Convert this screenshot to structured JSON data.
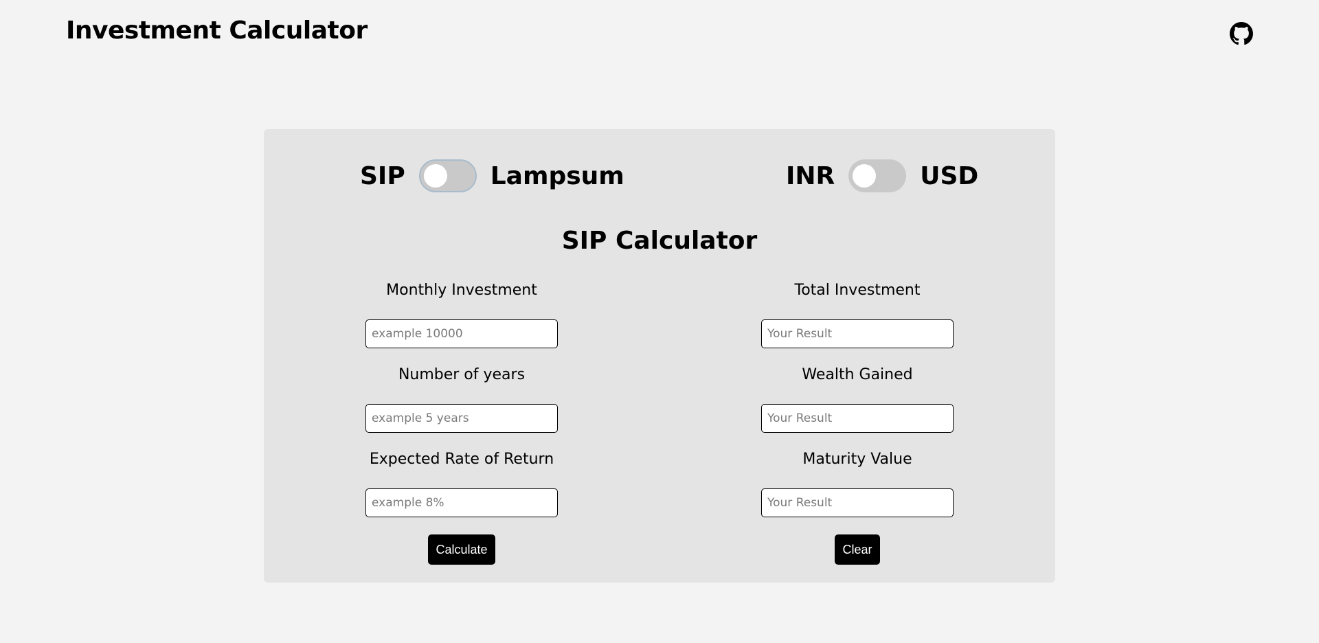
{
  "header": {
    "title": "Investment Calculator",
    "github_icon": "github-icon"
  },
  "toggles": {
    "mode": {
      "left_label": "SIP",
      "right_label": "Lampsum",
      "checked": false
    },
    "currency": {
      "left_label": "INR",
      "right_label": "USD",
      "checked": false
    }
  },
  "calculator": {
    "title": "SIP Calculator",
    "inputs": [
      {
        "label": "Monthly Investment",
        "placeholder": "example 10000",
        "value": ""
      },
      {
        "label": "Number of years",
        "placeholder": "example 5 years",
        "value": ""
      },
      {
        "label": "Expected Rate of Return",
        "placeholder": "example 8%",
        "value": ""
      }
    ],
    "results": [
      {
        "label": "Total Investment",
        "placeholder": "Your Result",
        "value": ""
      },
      {
        "label": "Wealth Gained",
        "placeholder": "Your Result",
        "value": ""
      },
      {
        "label": "Maturity Value",
        "placeholder": "Your Result",
        "value": ""
      }
    ],
    "calculate_label": "Calculate",
    "clear_label": "Clear"
  },
  "colors": {
    "page_background": "#f3f3f3",
    "card_background": "#e4e4e4",
    "button_background": "#000000",
    "switch_track": "#c9c9c9"
  }
}
